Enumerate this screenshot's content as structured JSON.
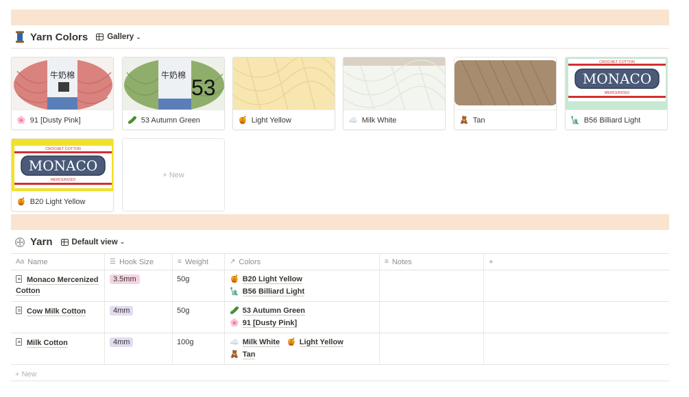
{
  "gallery": {
    "icon": "spool-icon",
    "title": "Yarn Colors",
    "view_label": "Gallery",
    "cards": [
      {
        "emoji": "🌸",
        "label": "91 [Dusty Pink]"
      },
      {
        "emoji": "🥒",
        "label": "53 Autumn Green"
      },
      {
        "emoji": "🍯",
        "label": "Light Yellow"
      },
      {
        "emoji": "☁️",
        "label": "Milk White"
      },
      {
        "emoji": "🧸",
        "label": "Tan"
      },
      {
        "emoji": "🗽",
        "label": "B56 Billiard Light"
      },
      {
        "emoji": "🍯",
        "label": "B20 Light Yellow"
      }
    ],
    "cover_texts": {
      "skein_number": "53",
      "monaco_top": "CROCHET COTTON",
      "monaco_logo": "MONACO",
      "monaco_bottom": "MERCERIZED",
      "chinese_label": "牛奶棉"
    },
    "new_card_label": "+ New"
  },
  "table_db": {
    "icon": "yarn-icon",
    "title": "Yarn",
    "view_label": "Default view",
    "columns": [
      {
        "icon": "Aa",
        "label": "Name"
      },
      {
        "icon": "☰",
        "label": "Hook Size"
      },
      {
        "icon": "≡",
        "label": "Weight"
      },
      {
        "icon": "↗",
        "label": "Colors"
      },
      {
        "icon": "≡",
        "label": "Notes"
      }
    ],
    "add_column_label": "+",
    "rows": [
      {
        "name_line1": "Monaco Mercenized",
        "name_line2": "Cotton",
        "hook": "3.5mm",
        "weight": "50g",
        "colors": [
          {
            "emoji": "🍯",
            "label": "B20 Light Yellow"
          },
          {
            "emoji": "🗽",
            "label": "B56 Billiard Light"
          }
        ]
      },
      {
        "name_line1": "Cow Milk Cotton",
        "hook": "4mm",
        "weight": "50g",
        "colors": [
          {
            "emoji": "🥒",
            "label": "53 Autumn Green"
          },
          {
            "emoji": "🌸",
            "label": "91 [Dusty Pink]"
          }
        ]
      },
      {
        "name_line1": "Milk Cotton",
        "hook": "4mm",
        "weight": "100g",
        "colors": [
          {
            "emoji": "☁️",
            "label": "Milk White"
          },
          {
            "emoji": "🍯",
            "label": "Light Yellow"
          },
          {
            "emoji": "🧸",
            "label": "Tan"
          }
        ]
      }
    ],
    "new_row_label": "+ New"
  },
  "colors": {
    "band": "#fae3cf",
    "tag_pink": "#f5d3e2",
    "tag_purple": "#e3dbf1"
  }
}
